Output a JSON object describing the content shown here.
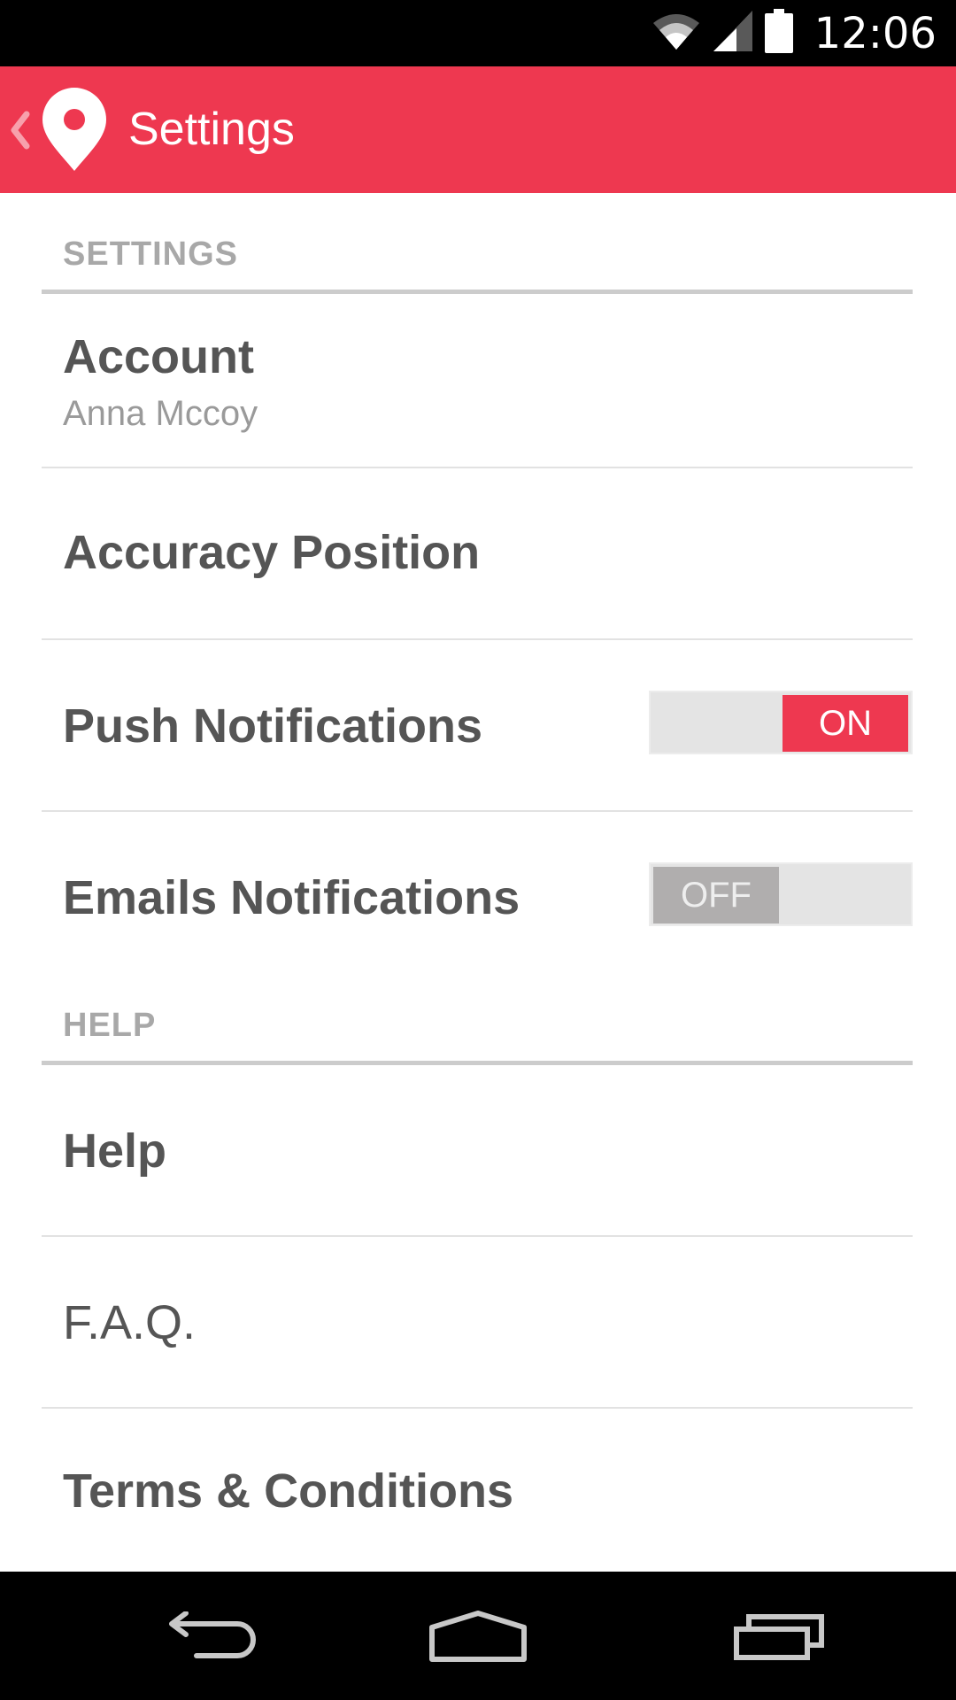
{
  "status_bar": {
    "time": "12:06",
    "icons": [
      "wifi-icon",
      "cell-signal-icon",
      "battery-icon"
    ]
  },
  "app_bar": {
    "title": "Settings",
    "back_icon": "chevron-left-icon",
    "logo_icon": "location-pin-icon",
    "color": "#ee3850"
  },
  "sections": {
    "settings": {
      "header": "SETTINGS",
      "account": {
        "title": "Account",
        "subtitle": "Anna Mccoy"
      },
      "accuracy": {
        "title": "Accuracy Position"
      },
      "push": {
        "title": "Push Notifications",
        "state": "ON"
      },
      "emails": {
        "title": "Emails Notifications",
        "state": "OFF"
      }
    },
    "help": {
      "header": "HELP",
      "help_item": {
        "title": "Help"
      },
      "faq": {
        "title": "F.A.Q."
      },
      "terms": {
        "title": "Terms & Conditions"
      }
    }
  },
  "nav_bar": {
    "icons": [
      "back-icon",
      "home-icon",
      "recent-apps-icon"
    ]
  },
  "colors": {
    "accent": "#ee3850",
    "toggle_off": "#b0aeae",
    "text": "#555555",
    "muted": "#a8a8a8"
  }
}
